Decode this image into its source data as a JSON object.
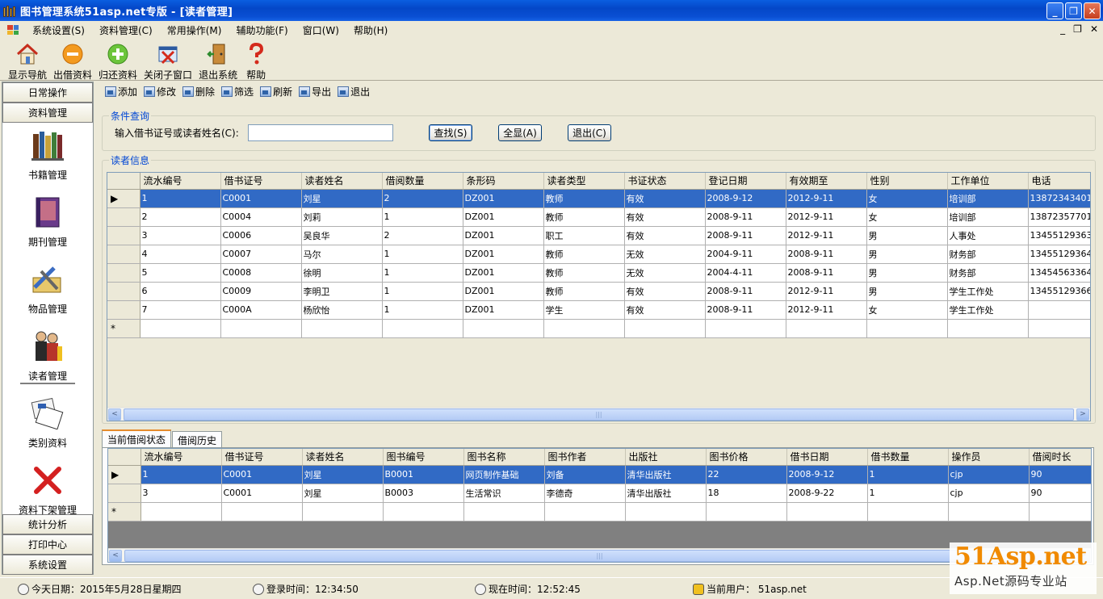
{
  "window": {
    "title": "图书管理系统51asp.net专版 - [读者管理]",
    "minimize": "_",
    "restore": "❐",
    "close": "✕"
  },
  "menu": [
    "系统设置(S)",
    "资料管理(C)",
    "常用操作(M)",
    "辅助功能(F)",
    "窗口(W)",
    "帮助(H)"
  ],
  "mdi_controls": [
    "_",
    "❐",
    "✕"
  ],
  "toolbar": [
    {
      "label": "显示导航",
      "icon": "home-icon"
    },
    {
      "label": "出借资料",
      "icon": "minus-circle-icon"
    },
    {
      "label": "归还资料",
      "icon": "plus-circle-icon"
    },
    {
      "label": "关闭子窗口",
      "icon": "close-window-icon"
    },
    {
      "label": "退出系统",
      "icon": "exit-door-icon"
    },
    {
      "label": "帮助",
      "icon": "help-icon"
    }
  ],
  "leftnav": {
    "top_headers": [
      "日常操作",
      "资料管理"
    ],
    "items": [
      {
        "label": "书籍管理",
        "icon": "books-icon"
      },
      {
        "label": "期刊管理",
        "icon": "journal-icon"
      },
      {
        "label": "物品管理",
        "icon": "tools-icon"
      },
      {
        "label": "读者管理",
        "icon": "readers-icon"
      },
      {
        "label": "类别资料",
        "icon": "category-icon"
      },
      {
        "label": "资料下架管理",
        "icon": "remove-x-icon"
      }
    ],
    "selected": "读者管理",
    "bottom_headers": [
      "统计分析",
      "打印中心",
      "系统设置"
    ]
  },
  "subtoolbar": [
    "添加",
    "修改",
    "删除",
    "筛选",
    "刷新",
    "导出",
    "退出"
  ],
  "query": {
    "group_title": "条件查询",
    "label": "输入借书证号或读者姓名(C):",
    "value": "",
    "buttons": {
      "search": "查找(S)",
      "show_all": "全显(A)",
      "exit": "退出(C)"
    }
  },
  "readers": {
    "group_title": "读者信息",
    "columns": [
      "流水编号",
      "借书证号",
      "读者姓名",
      "借阅数量",
      "条形码",
      "读者类型",
      "书证状态",
      "登记日期",
      "有效期至",
      "性别",
      "工作单位",
      "电话"
    ],
    "rows": [
      [
        "1",
        "C0001",
        "刘星",
        "2",
        "DZ001",
        "教师",
        "有效",
        "2008-9-12",
        "2012-9-11",
        "女",
        "培训部",
        "13872343401"
      ],
      [
        "2",
        "C0004",
        "刘莉",
        "1",
        "DZ001",
        "教师",
        "有效",
        "2008-9-11",
        "2012-9-11",
        "女",
        "培训部",
        "13872357701"
      ],
      [
        "3",
        "C0006",
        "吴良华",
        "2",
        "DZ001",
        "职工",
        "有效",
        "2008-9-11",
        "2012-9-11",
        "男",
        "人事处",
        "13455129363"
      ],
      [
        "4",
        "C0007",
        "马尔",
        "1",
        "DZ001",
        "教师",
        "无效",
        "2004-9-11",
        "2008-9-11",
        "男",
        "财务部",
        "13455129364"
      ],
      [
        "5",
        "C0008",
        "徐明",
        "1",
        "DZ001",
        "教师",
        "无效",
        "2004-4-11",
        "2008-9-11",
        "男",
        "财务部",
        "13454563364"
      ],
      [
        "6",
        "C0009",
        "李明卫",
        "1",
        "DZ001",
        "教师",
        "有效",
        "2008-9-11",
        "2012-9-11",
        "男",
        "学生工作处",
        "13455129366"
      ],
      [
        "7",
        "C000A",
        "杨欣怡",
        "1",
        "DZ001",
        "学生",
        "有效",
        "2008-9-11",
        "2012-9-11",
        "女",
        "学生工作处",
        ""
      ]
    ],
    "selected_row": 0
  },
  "tabs": [
    "当前借阅状态",
    "借阅历史"
  ],
  "borrowing": {
    "columns": [
      "流水编号",
      "借书证号",
      "读者姓名",
      "图书编号",
      "图书名称",
      "图书作者",
      "出版社",
      "图书价格",
      "借书日期",
      "借书数量",
      "操作员",
      "借阅时长"
    ],
    "rows": [
      [
        "1",
        "C0001",
        "刘星",
        "B0001",
        "网页制作基础",
        "刘备",
        "清华出版社",
        "22",
        "2008-9-12",
        "1",
        "cjp",
        "90"
      ],
      [
        "3",
        "C0001",
        "刘星",
        "B0003",
        "生活常识",
        "李德奇",
        "清华出版社",
        "18",
        "2008-9-22",
        "1",
        "cjp",
        "90"
      ]
    ],
    "selected_row": 0
  },
  "status": {
    "today": "今天日期：2015年5月28日星期四",
    "login": "登录时间：12:34:50",
    "now": "现在时间：12:52:45",
    "user": "当前用户： 51asp.net"
  },
  "watermark": {
    "title": "51Asp.net",
    "subtitle": "Asp.Net源码专业站"
  }
}
